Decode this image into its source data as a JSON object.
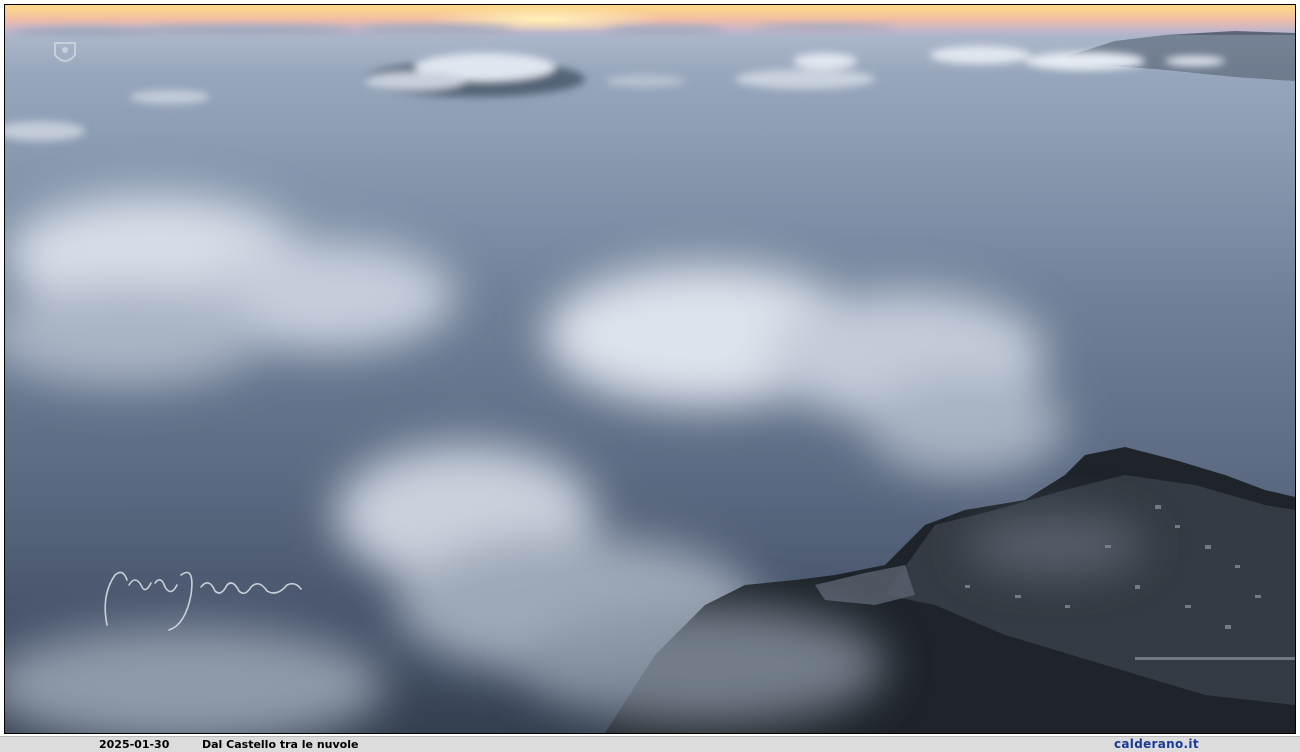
{
  "caption": {
    "date": "2025-01-30",
    "title": "Dal Castello tra le nuvole",
    "site": "calderano.it"
  },
  "colors": {
    "sea": "#6f7f97",
    "sky_glow": "#f2c98a",
    "cloud": "#dfe5ee",
    "land": "#1e2429",
    "caption_bar": "#dcdcdc",
    "site_link": "#1a3a9c"
  },
  "icons": {
    "watermark": "crest-watermark-icon",
    "signature": "handwritten-signature"
  }
}
